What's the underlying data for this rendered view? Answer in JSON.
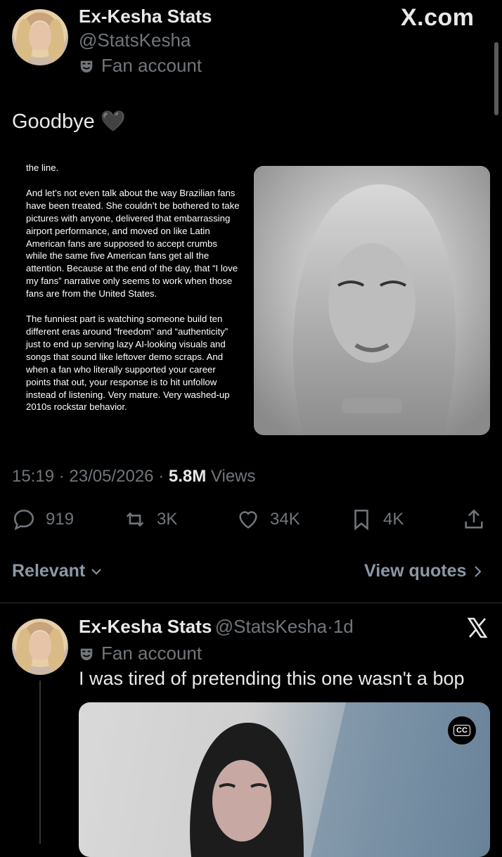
{
  "header": {
    "name": "Ex-Kesha Stats",
    "handle": "@StatsKesha",
    "label": "Fan account",
    "site": "X.com"
  },
  "tweet": {
    "text": "Goodbye 🖤",
    "doc_paragraphs": [
      "the line.",
      "And let’s not even talk about the way Brazilian fans have been treated. She couldn’t be bothered to take pictures with anyone, delivered that embarrassing airport performance, and moved on like Latin American fans are supposed to accept crumbs while the same five American fans get all the attention. Because at the end of the day, that “I love my fans” narrative only seems to work when those fans are from the United States.",
      "The funniest part is watching someone build ten different eras around “freedom” and “authenticity” just to end up serving lazy AI-looking visuals and songs that sound like leftover demo scraps. And when a fan who literally supported your career points that out, your response is to hit unfollow instead of listening. Very mature. Very washed-up 2010s rockstar behavior."
    ],
    "time": "15:19",
    "date": "23/05/2026",
    "views_count": "5.8M",
    "views_label": "Views",
    "separator": "·"
  },
  "actions": {
    "replies": "919",
    "reposts": "3K",
    "likes": "34K",
    "bookmarks": "4K"
  },
  "sort": {
    "relevant_label": "Relevant",
    "view_quotes_label": "View quotes"
  },
  "reply": {
    "name": "Ex-Kesha Stats",
    "handle": "@StatsKesha",
    "age": "1d",
    "label": "Fan account",
    "text": "I was tired of pretending this one wasn't a bop",
    "cc_label": "CC"
  },
  "colors": {
    "background": "#000000",
    "text": "#e7e9ea",
    "muted": "#71767b"
  }
}
